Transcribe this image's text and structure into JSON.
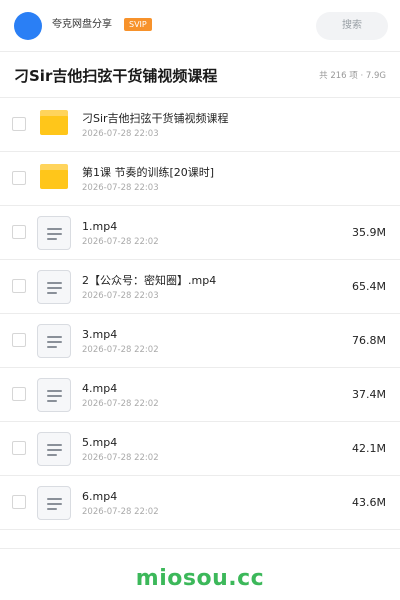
{
  "header": {
    "user_name": "夸克网盘分享",
    "badge": "SVIP",
    "search_label": "搜索"
  },
  "folder": {
    "title": "刁Sir吉他扫弦干货铺视频课程",
    "meta": "共 216 项 · 7.9G"
  },
  "files": [
    {
      "type": "folder",
      "name": "刁Sir吉他扫弦干货铺视频课程",
      "date": "2026-07-28 22:03",
      "size": ""
    },
    {
      "type": "folder",
      "name": "第1课 节奏的训练[20课时]",
      "date": "2026-07-28 22:03",
      "size": ""
    },
    {
      "type": "file",
      "name": "1.mp4",
      "date": "2026-07-28 22:02",
      "size": "35.9M"
    },
    {
      "type": "file",
      "name": "2【公众号：密知圈】.mp4",
      "date": "2026-07-28 22:03",
      "size": "65.4M"
    },
    {
      "type": "file",
      "name": "3.mp4",
      "date": "2026-07-28 22:02",
      "size": "76.8M"
    },
    {
      "type": "file",
      "name": "4.mp4",
      "date": "2026-07-28 22:02",
      "size": "37.4M"
    },
    {
      "type": "file",
      "name": "5.mp4",
      "date": "2026-07-28 22:02",
      "size": "42.1M"
    },
    {
      "type": "file",
      "name": "6.mp4",
      "date": "2026-07-28 22:02",
      "size": "43.6M"
    }
  ],
  "watermark": "miosou.cc",
  "colors": {
    "avatar": "#2a7ff5",
    "badge": "#f7922b",
    "folder": "#ffc61a",
    "watermark": "#3cb85a"
  }
}
